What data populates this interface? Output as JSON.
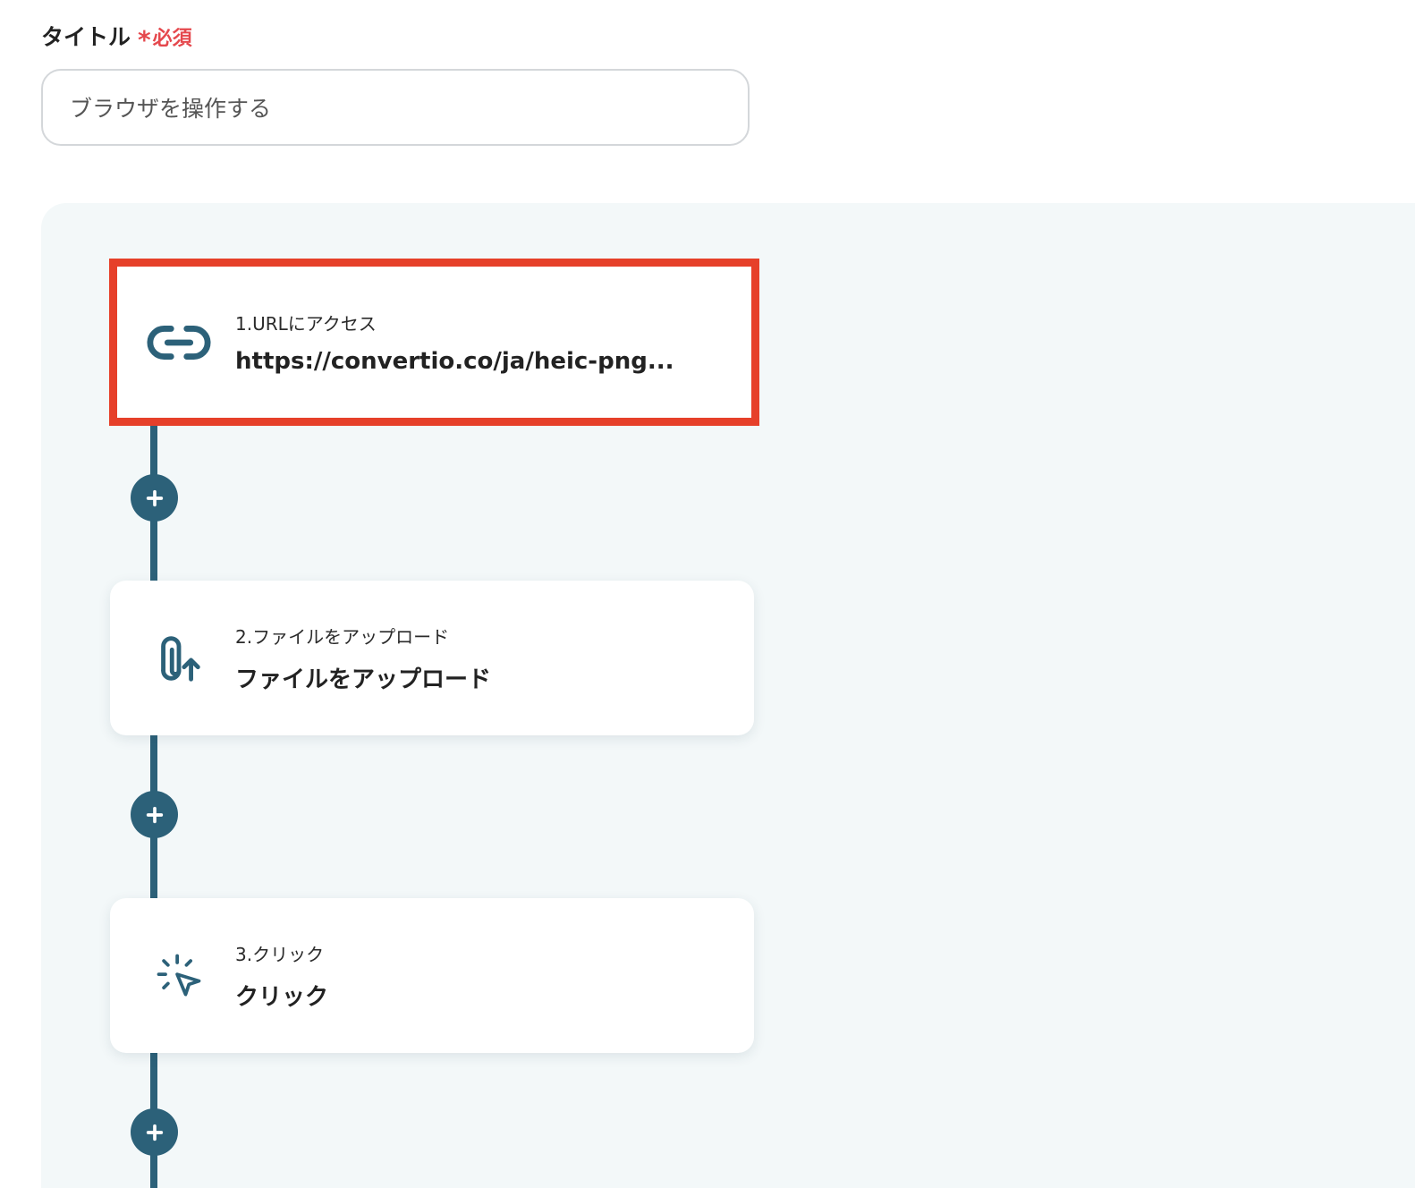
{
  "title_field": {
    "label": "タイトル",
    "required_mark": "*",
    "required_text": "必須",
    "value": "ブラウザを操作する"
  },
  "steps": [
    {
      "label": "1.URLにアクセス",
      "value": "https://convertio.co/ja/heic-png...",
      "icon": "link-icon",
      "selected": true
    },
    {
      "label": "2.ファイルをアップロード",
      "value": "ファイルをアップロード",
      "icon": "paperclip-upload-icon",
      "selected": false
    },
    {
      "label": "3.クリック",
      "value": "クリック",
      "icon": "click-cursor-icon",
      "selected": false
    }
  ],
  "colors": {
    "accent": "#2c6179",
    "selection_border": "#e6402a",
    "required": "#e5484d",
    "canvas_bg": "#f3f8f9"
  }
}
